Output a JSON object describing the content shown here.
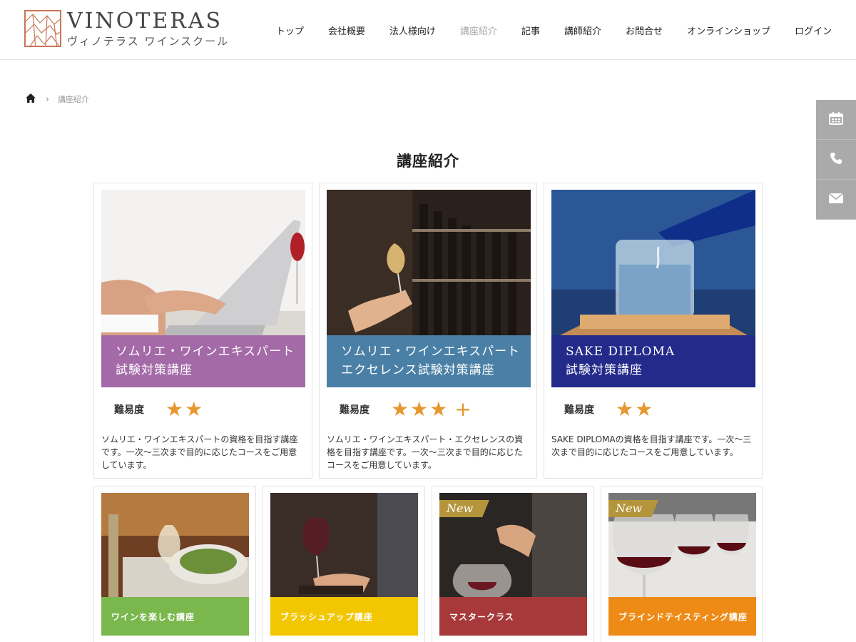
{
  "header": {
    "logo_title": "VINOTERAS",
    "logo_subtitle": "ヴィノテラス ワインスクール",
    "nav": [
      "トップ",
      "会社概要",
      "法人様向け",
      "講座紹介",
      "記事",
      "講師紹介",
      "お問合せ",
      "オンラインショップ",
      "ログイン"
    ],
    "active_nav": "講座紹介"
  },
  "breadcrumb": {
    "home_icon": "home-icon",
    "current": "講座紹介"
  },
  "side_tabs": [
    "calendar-icon",
    "phone-icon",
    "mail-icon"
  ],
  "page_title": "講座紹介",
  "courses": [
    {
      "banner_line1": "ソムリエ・ワインエキスパート",
      "banner_line2": "試験対策講座",
      "banner_color": "#a46aa8",
      "difficulty_label": "難易度",
      "stars": "★★",
      "plus": "",
      "description": "ソムリエ・ワインエキスパートの資格を目指す講座です。一次〜三次まで目的に応じたコースをご用意しています。"
    },
    {
      "banner_line1": "ソムリエ・ワインエキスパート",
      "banner_line2": "エクセレンス試験対策講座",
      "banner_color": "#4b80a6",
      "difficulty_label": "難易度",
      "stars": "★★★",
      "plus": "+",
      "description": "ソムリエ・ワインエキスパート・エクセレンスの資格を目指す講座です。一次〜三次まで目的に応じたコースをご用意しています。"
    },
    {
      "banner_line1": "SAKE DIPLOMA",
      "banner_line2": "試験対策講座",
      "banner_color": "#232a8a",
      "difficulty_label": "難易度",
      "stars": "★★",
      "plus": "",
      "description": "SAKE DIPLOMAの資格を目指す講座です。一次〜三次まで目的に応じたコースをご用意しています。"
    }
  ],
  "courses_row2": [
    {
      "label": "ワインを楽しむ講座",
      "color": "#7ab84d",
      "new": ""
    },
    {
      "label": "ブラッシュアップ講座",
      "color": "#f2c600",
      "new": ""
    },
    {
      "label": "マスタークラス",
      "color": "#a8393a",
      "new": "New"
    },
    {
      "label": "ブラインドテイスティング講座",
      "color": "#ee8b16",
      "new": "New"
    }
  ]
}
